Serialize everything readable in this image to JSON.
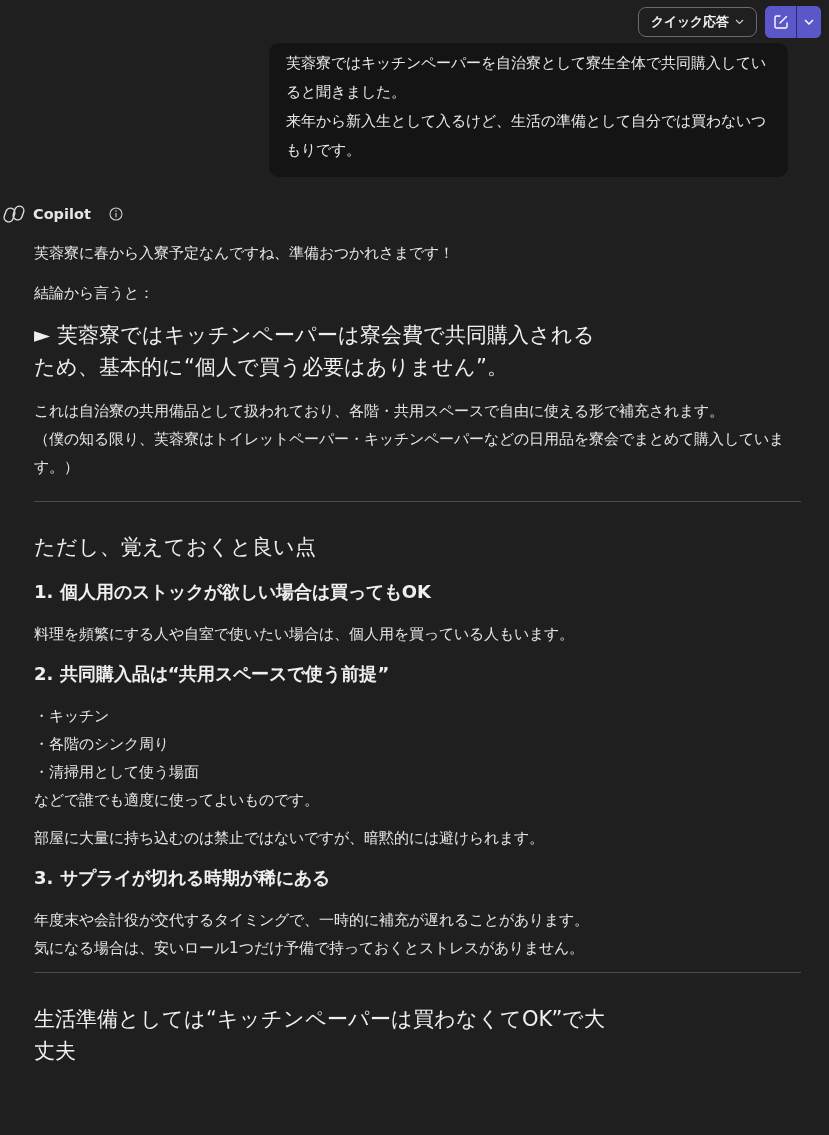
{
  "toolbar": {
    "quick_reply": "クイック応答"
  },
  "user_message": {
    "lines": [
      "芙蓉寮ではキッチンペーパーを自治寮として寮生全体で共同購入していると聞きました。",
      "来年から新入生として入るけど、生活の準備として自分では買わないつもりです。"
    ]
  },
  "assistant": {
    "name": "Copilot",
    "blocks": [
      {
        "kind": "p",
        "text": "芙蓉寮に春から入寮予定なんですね、準備おつかれさまです！"
      },
      {
        "kind": "p",
        "text": "結論から言うと："
      },
      {
        "kind": "title",
        "text": "► 芙蓉寮ではキッチンペーパーは寮会費で共同購入されるため、基本的に“個人で買う必要はありません”。"
      },
      {
        "kind": "p",
        "text": "これは自治寮の共用備品として扱われており、各階・共用スペースで自由に使える形で補充されます。"
      },
      {
        "kind": "p_tight",
        "text": "（僕の知る限り、芙蓉寮はトイレットペーパー・キッチンペーパーなどの日用品を寮会でまとめて購入しています。）"
      },
      {
        "kind": "rule"
      },
      {
        "kind": "section",
        "text": "ただし、覚えておくと良い点"
      },
      {
        "kind": "heading",
        "text": "1. 個人用のストックが欲しい場合は買ってもOK"
      },
      {
        "kind": "p",
        "text": "料理を頻繁にする人や自室で使いたい場合は、個人用を買っている人もいます。"
      },
      {
        "kind": "heading",
        "text": "2. 共同購入品は“共用スペースで使う前提”"
      },
      {
        "kind": "item",
        "text": "・キッチン"
      },
      {
        "kind": "item",
        "text": "・各階のシンク周り"
      },
      {
        "kind": "item",
        "text": "・清掃用として使う場面"
      },
      {
        "kind": "item",
        "text": "などで誰でも適度に使ってよいものです。"
      },
      {
        "kind": "p",
        "text": "部屋に大量に持ち込むのは禁止ではないですが、暗黙的には避けられます。"
      },
      {
        "kind": "heading",
        "text": "3. サプライが切れる時期が稀にある"
      },
      {
        "kind": "item",
        "text": "年度末や会計役が交代するタイミングで、一時的に補充が遅れることがあります。"
      },
      {
        "kind": "item",
        "text": "気になる場合は、安いロール1つだけ予備で持っておくとストレスがありません。"
      },
      {
        "kind": "rule"
      },
      {
        "kind": "title",
        "text": "生活準備としては“キッチンペーパーは買わなくてOK”で大丈夫"
      }
    ]
  }
}
